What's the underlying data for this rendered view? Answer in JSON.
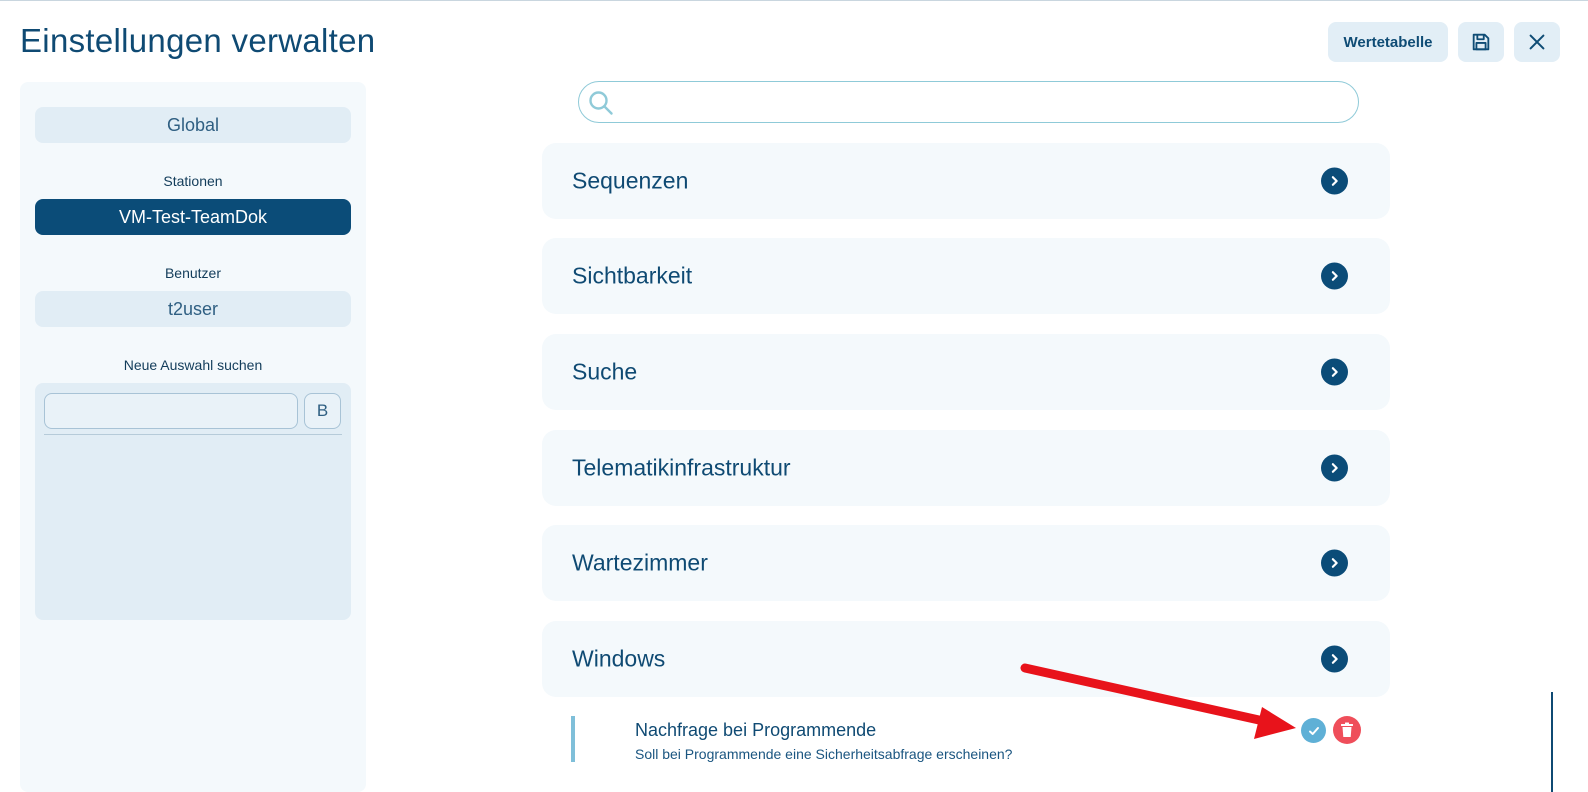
{
  "header": {
    "title": "Einstellungen verwalten",
    "value_table_label": "Wertetabelle",
    "save_icon": "save-icon",
    "close_icon": "close-icon"
  },
  "sidebar": {
    "global_label": "Global",
    "stations_label": "Stationen",
    "station_value": "VM-Test-TeamDok",
    "users_label": "Benutzer",
    "user_value": "t2user",
    "new_search_label": "Neue Auswahl suchen",
    "search_button_label": "B"
  },
  "main": {
    "search_placeholder": "",
    "sections": [
      {
        "label": "Sequenzen"
      },
      {
        "label": "Sichtbarkeit"
      },
      {
        "label": "Suche"
      },
      {
        "label": "Telematikinfrastruktur"
      },
      {
        "label": "Wartezimmer"
      },
      {
        "label": "Windows"
      }
    ],
    "setting": {
      "title": "Nachfrage bei Programmende",
      "description": "Soll bei Programmende eine Sicherheitsabfrage erscheinen?"
    }
  },
  "colors": {
    "brand": "#0b4c78",
    "accent": "#5fb0d6",
    "danger": "#ef4e5a",
    "annotation": "#e8131b"
  }
}
